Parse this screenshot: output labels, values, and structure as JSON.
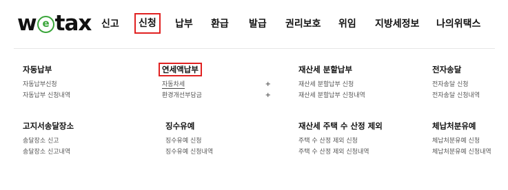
{
  "logo": {
    "prefix": "w",
    "mark": "e",
    "suffix": "tax"
  },
  "nav": [
    {
      "label": "신고"
    },
    {
      "label": "신청"
    },
    {
      "label": "납부"
    },
    {
      "label": "환급"
    },
    {
      "label": "발급"
    },
    {
      "label": "권리보호"
    },
    {
      "label": "위임"
    },
    {
      "label": "지방세정보"
    },
    {
      "label": "나의위택스"
    }
  ],
  "menu": {
    "col1": [
      {
        "title": "자동납부",
        "items": [
          "자동납부신청",
          "자동납부 신청내역"
        ]
      },
      {
        "title": "고지서송달장소",
        "items": [
          "송달장소 신고",
          "송달장소 신고내역"
        ]
      }
    ],
    "col2": [
      {
        "title": "연세액납부",
        "items": [
          "자동차세",
          "환경개선부담금"
        ],
        "plus": "+"
      },
      {
        "title": "징수유예",
        "items": [
          "징수유예 신청",
          "징수유예 신청내역"
        ]
      }
    ],
    "col3": [
      {
        "title": "재산세 분할납부",
        "items": [
          "재산세 분할납부 신청",
          "재산세 분할납부 신청내역"
        ]
      },
      {
        "title": "재산세 주택 수 산정 제외",
        "items": [
          "주택 수 산정 제외 신청",
          "주택 수 산정 제외 신청내역"
        ]
      }
    ],
    "col4": [
      {
        "title": "전자송달",
        "items": [
          "전자송달 신청",
          "전자송달 신청내역"
        ]
      },
      {
        "title": "체납처분유예",
        "items": [
          "체납처분유예 신청",
          "체납처분유예 신청내역"
        ]
      }
    ]
  },
  "colors": {
    "highlight": "#e02020",
    "logo_green": "#3aa53a"
  }
}
